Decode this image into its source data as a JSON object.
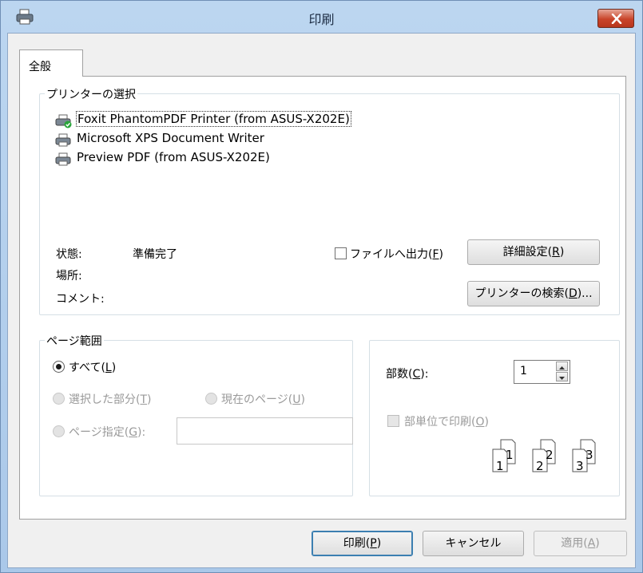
{
  "window": {
    "title": "印刷",
    "icon": "printer-icon",
    "close_icon": "close-icon"
  },
  "tabs": [
    {
      "label": "全般"
    }
  ],
  "printer_group": {
    "label": "プリンターの選択",
    "printers": [
      {
        "name": "Foxit PhantomPDF Printer (from ASUS-X202E)",
        "selected": true,
        "default": true
      },
      {
        "name": "Microsoft XPS Document Writer",
        "selected": false
      },
      {
        "name": "Preview PDF (from ASUS-X202E)",
        "selected": false
      }
    ],
    "status_label": "状態:",
    "status_value": "準備完了",
    "location_label": "場所:",
    "comment_label": "コメント:",
    "print_to_file": {
      "label_main": "ファイルへ出力(",
      "mnemonic": "F",
      "label_end": ")",
      "checked": false
    },
    "preferences_button": {
      "main": "詳細設定(",
      "mnemonic": "R",
      "end": ")"
    },
    "find_printer_button": {
      "main": "プリンターの検索(",
      "mnemonic": "D",
      "end": ")..."
    }
  },
  "page_range": {
    "label": "ページ範囲",
    "all": {
      "main": "すべて(",
      "mnemonic": "L",
      "end": ")",
      "checked": true
    },
    "selection": {
      "main": "選択した部分(",
      "mnemonic": "T",
      "end": ")",
      "enabled": false
    },
    "current_page": {
      "main": "現在のページ(",
      "mnemonic": "U",
      "end": ")",
      "enabled": false
    },
    "pages": {
      "main": "ページ指定(",
      "mnemonic": "G",
      "end": "):",
      "enabled": false,
      "value": ""
    }
  },
  "copies": {
    "label_main": "部数(",
    "mnemonic": "C",
    "label_end": "):",
    "value": "1",
    "collate": {
      "main": "部単位で印刷(",
      "mnemonic": "O",
      "end": ")",
      "enabled": false,
      "checked": false
    },
    "collate_pages": [
      "1",
      "1",
      "2",
      "2",
      "3",
      "3"
    ]
  },
  "footer": {
    "print_button": {
      "main": "印刷(",
      "mnemonic": "P",
      "end": ")"
    },
    "cancel_button": "キャンセル",
    "apply_button": {
      "main": "適用(",
      "mnemonic": "A",
      "end": ")",
      "enabled": false
    }
  }
}
